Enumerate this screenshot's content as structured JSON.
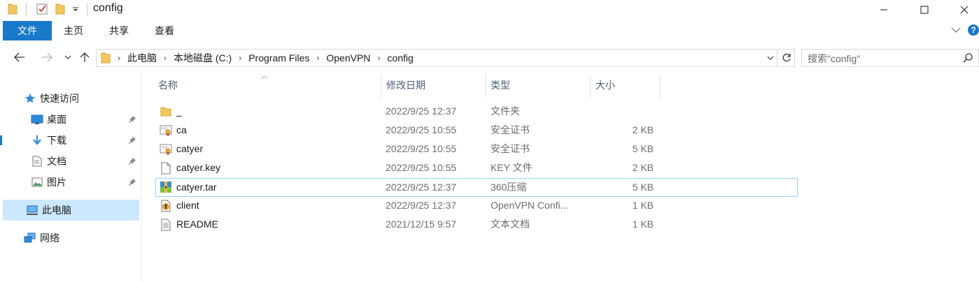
{
  "window": {
    "title": "config",
    "controls": {
      "minimize": "—",
      "maximize": "☐",
      "close": "✕"
    }
  },
  "ribbon": {
    "tabs": [
      "文件",
      "主页",
      "共享",
      "查看"
    ],
    "help": "?"
  },
  "nav": {
    "breadcrumbs": [
      "此电脑",
      "本地磁盘 (C:)",
      "Program Files",
      "OpenVPN",
      "config"
    ],
    "search_placeholder": "搜索\"config\""
  },
  "sidebar": {
    "items": [
      {
        "label": "快速访问",
        "icon": "star-icon",
        "pinned": false
      },
      {
        "label": "桌面",
        "icon": "desktop-icon",
        "pinned": true
      },
      {
        "label": "下载",
        "icon": "download-icon",
        "pinned": true
      },
      {
        "label": "文档",
        "icon": "document-icon",
        "pinned": true
      },
      {
        "label": "图片",
        "icon": "pictures-icon",
        "pinned": true
      },
      {
        "label": "此电脑",
        "icon": "computer-icon",
        "pinned": false,
        "selected": true
      },
      {
        "label": "网络",
        "icon": "network-icon",
        "pinned": false
      }
    ]
  },
  "columns": {
    "name": "名称",
    "date": "修改日期",
    "type": "类型",
    "size": "大小"
  },
  "files": [
    {
      "name": "_",
      "date": "2022/9/25 12:37",
      "type": "文件夹",
      "size": "",
      "icon": "folder-icon"
    },
    {
      "name": "ca",
      "date": "2022/9/25 10:55",
      "type": "安全证书",
      "size": "2 KB",
      "icon": "certificate-icon"
    },
    {
      "name": "catyer",
      "date": "2022/9/25 10:55",
      "type": "安全证书",
      "size": "5 KB",
      "icon": "certificate-icon"
    },
    {
      "name": "catyer.key",
      "date": "2022/9/25 10:55",
      "type": "KEY 文件",
      "size": "2 KB",
      "icon": "blank-file-icon"
    },
    {
      "name": "catyer.tar",
      "date": "2022/9/25 12:37",
      "type": "360压缩",
      "size": "5 KB",
      "icon": "archive-icon",
      "focused": true
    },
    {
      "name": "client",
      "date": "2022/9/25 12:37",
      "type": "OpenVPN Confi...",
      "size": "1 KB",
      "icon": "openvpn-config-icon"
    },
    {
      "name": "README",
      "date": "2021/12/15 9:57",
      "type": "文本文档",
      "size": "1 KB",
      "icon": "text-file-icon"
    }
  ],
  "colors": {
    "accent": "#1979ca",
    "selected": "#cce8ff",
    "focus_border": "#99d1ff",
    "folder": "#f5c65a",
    "header_text": "#4c607a"
  }
}
